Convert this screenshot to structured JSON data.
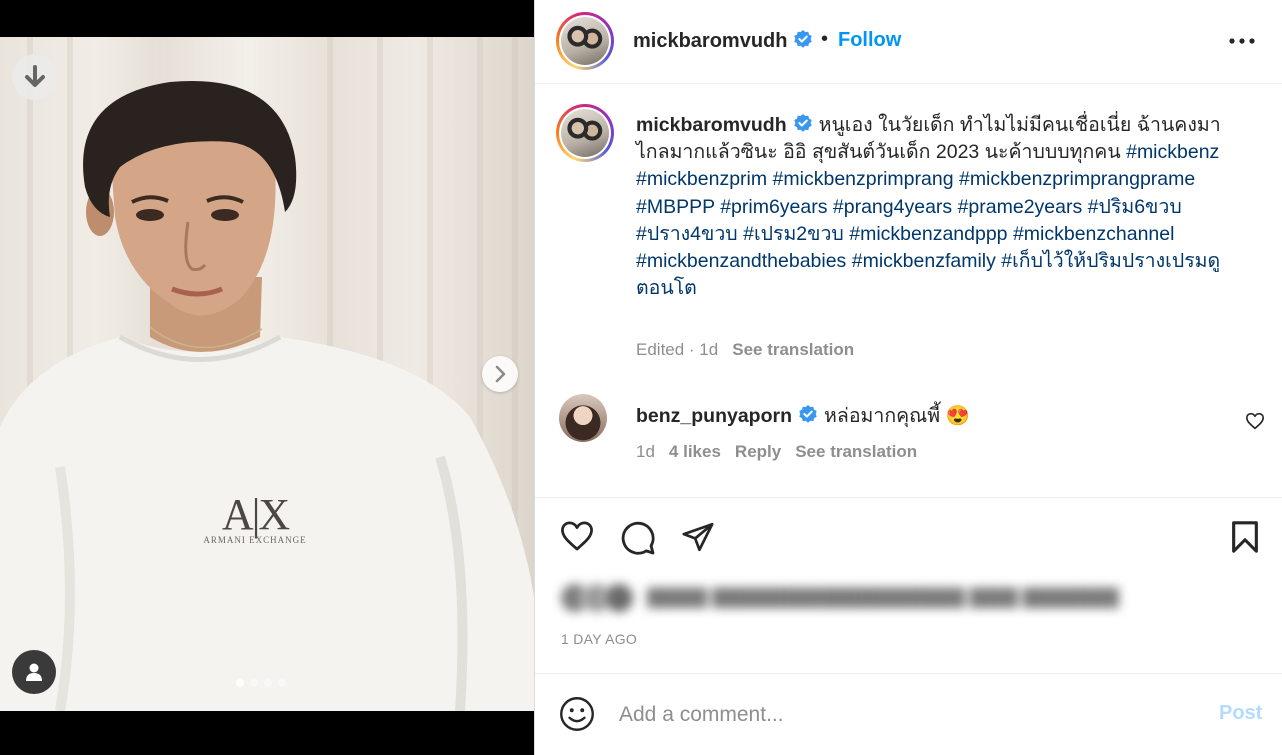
{
  "post": {
    "username": "mickbaromvudh",
    "follow_label": "Follow",
    "header_separator": "•",
    "caption": {
      "text_1": "หนูเอง ในวัยเด็ก ทำไมไม่มีคนเชื่อเนี่ย ฉ้านคงมาไกลมากแล้วซินะ อิอิ สุขสันต์วันเด็ก 2023 นะค้าบบบทุกคน",
      "hashtags": [
        "#mickbenz",
        "#mickbenzprim",
        "#mickbenzprimprang",
        "#mickbenzprimprangprame",
        "#MBPPP",
        "#prim6years",
        "#prang4years",
        "#prame2years",
        "#ปริม6ขวบ",
        "#ปราง4ขวบ",
        "#เปรม2ขวบ",
        "#mickbenzandppp",
        "#mickbenzchannel",
        "#mickbenzandthebabies",
        "#mickbenzfamily",
        "#เก็บไว้ให้ปริมปรางเปรมดูตอนโต"
      ],
      "edited": "Edited · 1d",
      "see_translation": "See translation"
    },
    "shirt_logo": "A|X",
    "shirt_subtext": "ARMANI EXCHANGE",
    "date": "1 DAY AGO"
  },
  "carousel": {
    "count": 4,
    "active": 0
  },
  "comment": {
    "username": "benz_punyaporn",
    "text": "หล่อมากคุณพี้ 😍",
    "time": "1d",
    "likes": "4 likes",
    "reply": "Reply",
    "see_translation": "See translation"
  },
  "add_comment": {
    "placeholder": "Add a comment...",
    "post_label": "Post"
  },
  "icons": {
    "download": "arrow-down-icon",
    "next": "chevron-right-icon",
    "tag": "user-icon",
    "verified": "verified-badge-icon",
    "more": "more-horizontal-icon",
    "like": "heart-icon",
    "comment": "comment-icon",
    "share": "send-icon",
    "save": "bookmark-icon",
    "emoji": "emoji-icon"
  },
  "colors": {
    "accent": "#0095f6",
    "hashtag": "#00376b",
    "verified": "#3897f0",
    "muted": "#8e8e8e"
  }
}
